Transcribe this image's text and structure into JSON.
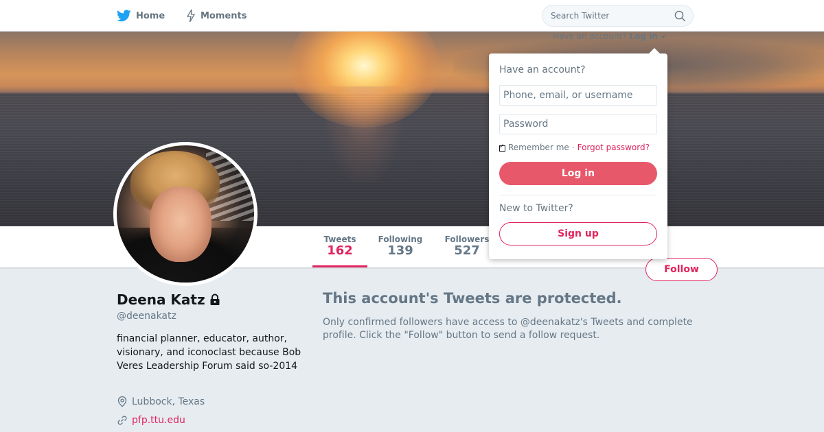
{
  "nav": {
    "home_label": "Home",
    "moments_label": "Moments",
    "search_placeholder": "Search Twitter"
  },
  "login_hint": {
    "text": "Have an account?",
    "link": "Log in"
  },
  "profile_nav": {
    "stats": [
      {
        "label": "Tweets",
        "value": "162"
      },
      {
        "label": "Following",
        "value": "139"
      },
      {
        "label": "Followers",
        "value": "527"
      }
    ],
    "follow_label": "Follow"
  },
  "profile": {
    "name": "Deena Katz",
    "handle": "@deenakatz",
    "bio": "financial planner, educator, author, visionary, and iconoclast because Bob Veres Leadership Forum said so-2014",
    "location": "Lubbock, Texas",
    "url": "pfp.ttu.edu"
  },
  "protected": {
    "title": "This account's Tweets are protected.",
    "text": "Only confirmed followers have access to @deenakatz's Tweets and complete profile. Click the \"Follow\" button to send a follow request."
  },
  "login_dropdown": {
    "heading": "Have an account?",
    "username_placeholder": "Phone, email, or username",
    "password_placeholder": "Password",
    "remember_label": "Remember me",
    "separator": "·",
    "forgot_label": "Forgot password?",
    "login_button": "Log in",
    "new_heading": "New to Twitter?",
    "signup_button": "Sign up"
  },
  "colors": {
    "accent": "#e0245e",
    "login_button_bg": "#e8586b",
    "twitter_blue": "#1da1f2",
    "muted_text": "#657786",
    "page_bg": "#e6ecf0"
  },
  "icons": [
    "twitter-bird-icon",
    "lightning-icon",
    "search-icon",
    "lock-icon",
    "location-pin-icon",
    "link-icon",
    "dropdown-caret-icon"
  ]
}
